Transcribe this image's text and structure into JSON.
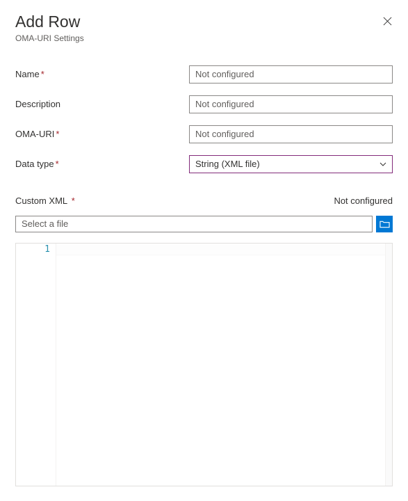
{
  "header": {
    "title": "Add Row",
    "subtitle": "OMA-URI Settings"
  },
  "form": {
    "name": {
      "label": "Name",
      "placeholder": "Not configured",
      "value": ""
    },
    "description": {
      "label": "Description",
      "placeholder": "Not configured",
      "value": ""
    },
    "omaUri": {
      "label": "OMA-URI",
      "placeholder": "Not configured",
      "value": ""
    },
    "dataType": {
      "label": "Data type",
      "value": "String (XML file)"
    }
  },
  "customXml": {
    "label": "Custom XML",
    "status": "Not configured",
    "filePlaceholder": "Select a file"
  },
  "editor": {
    "lines": [
      "1"
    ],
    "content": ""
  }
}
